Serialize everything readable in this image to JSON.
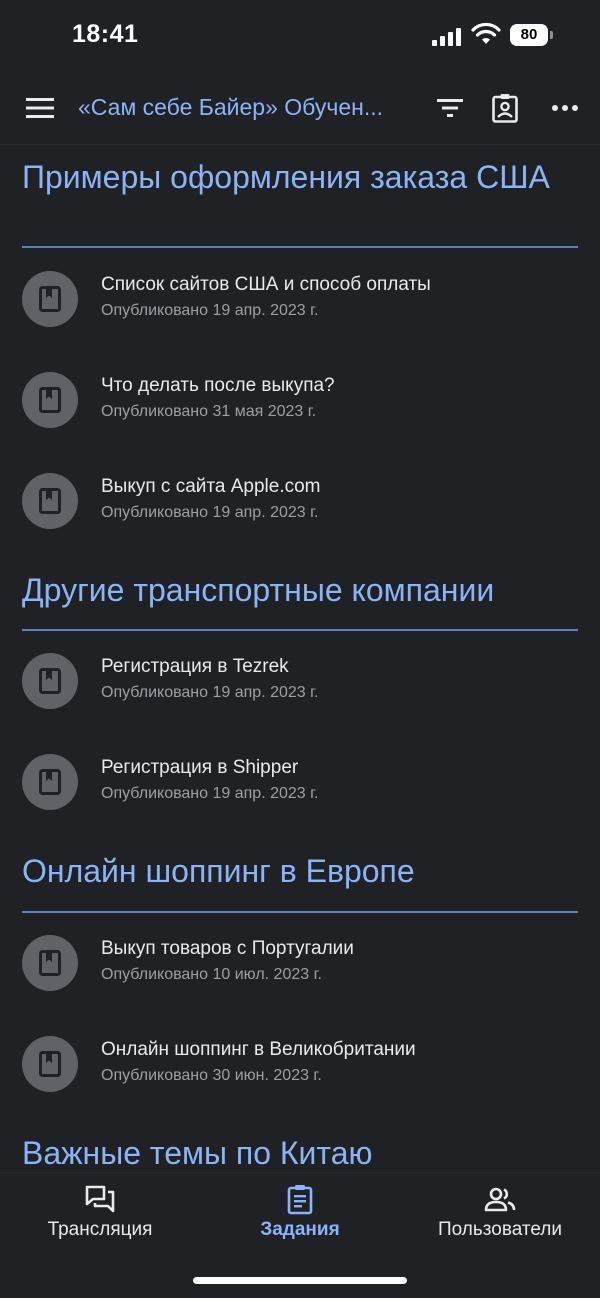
{
  "status": {
    "time": "18:41",
    "battery": "80"
  },
  "app_bar": {
    "title": "«Сам себе Байер» Обучен..."
  },
  "topics": [
    {
      "title": "Примеры оформления заказа США",
      "items": [
        {
          "title": "Список сайтов США и способ оплаты",
          "date": "Опубликовано 19 апр. 2023 г."
        },
        {
          "title": "Что делать после выкупа?",
          "date": "Опубликовано 31 мая 2023 г."
        },
        {
          "title": "Выкуп с сайта Apple.com",
          "date": "Опубликовано 19 апр. 2023 г."
        }
      ]
    },
    {
      "title": "Другие транспортные компании",
      "items": [
        {
          "title": "Регистрация в Tezrek",
          "date": "Опубликовано 19 апр. 2023 г."
        },
        {
          "title": "Регистрация в Shipper",
          "date": "Опубликовано 19 апр. 2023 г."
        }
      ]
    },
    {
      "title": "Онлайн шоппинг в Европе",
      "items": [
        {
          "title": "Выкуп товаров с Португалии",
          "date": "Опубликовано 10 июл. 2023 г."
        },
        {
          "title": "Онлайн шоппинг в Великобритании",
          "date": "Опубликовано 30 июн. 2023 г."
        }
      ]
    },
    {
      "title": "Важные темы по Китаю",
      "items": []
    }
  ],
  "bottom_nav": [
    {
      "label": "Трансляция",
      "icon": "stream-icon",
      "active": false
    },
    {
      "label": "Задания",
      "icon": "classwork-icon",
      "active": true
    },
    {
      "label": "Пользователи",
      "icon": "people-icon",
      "active": false
    }
  ],
  "colors": {
    "background": "#202124",
    "accent": "#8ab4f8",
    "icon_circle": "#5f6368",
    "secondary_text": "#9aa0a6"
  }
}
